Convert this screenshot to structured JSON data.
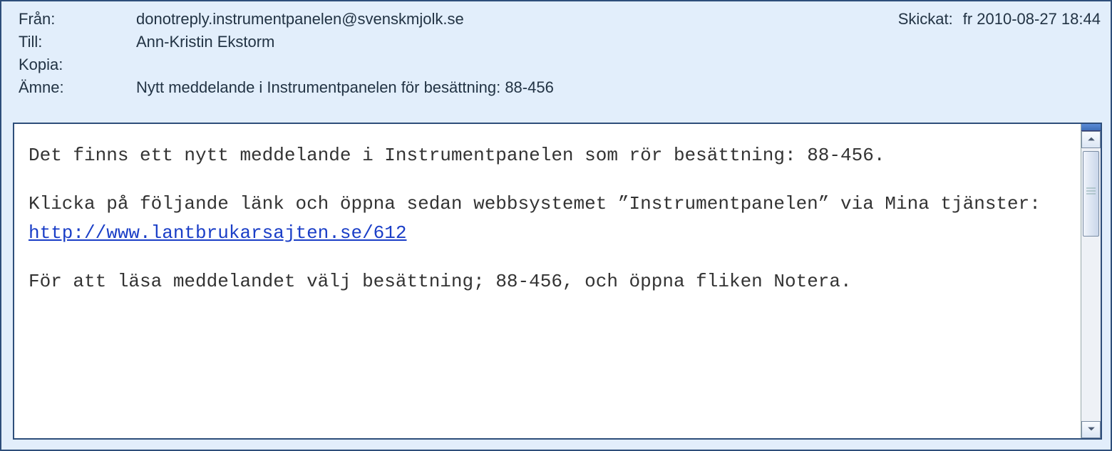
{
  "header": {
    "labels": {
      "from": "Från:",
      "to": "Till:",
      "cc": "Kopia:",
      "subject": "Ämne:",
      "sent": "Skickat:"
    },
    "from": "donotreply.instrumentpanelen@svenskmjolk.se",
    "to": "Ann-Kristin Ekstorm",
    "cc": "",
    "subject_prefix": "Nytt meddelande i Instrumentpanelen för besättning: ",
    "subject_id": "88-456",
    "sent": "fr 2010-08-27 18:44"
  },
  "body": {
    "p1_a": "Det finns ett nytt meddelande i Instrumentpanelen som rör besättning: ",
    "p1_b": "88-456",
    "p1_c": ".",
    "p2_a": "Klicka på följande länk och öppna sedan webbsystemet ”Instrumentpanelen” via Mina tjänster: ",
    "link_text": "http://www.lantbrukarsajten.se/612",
    "link_href": "http://www.lantbrukarsajten.se/612",
    "p3_a": "För att läsa meddelandet välj besättning; ",
    "p3_b": "88-456",
    "p3_c": ", och öppna fliken Notera."
  }
}
